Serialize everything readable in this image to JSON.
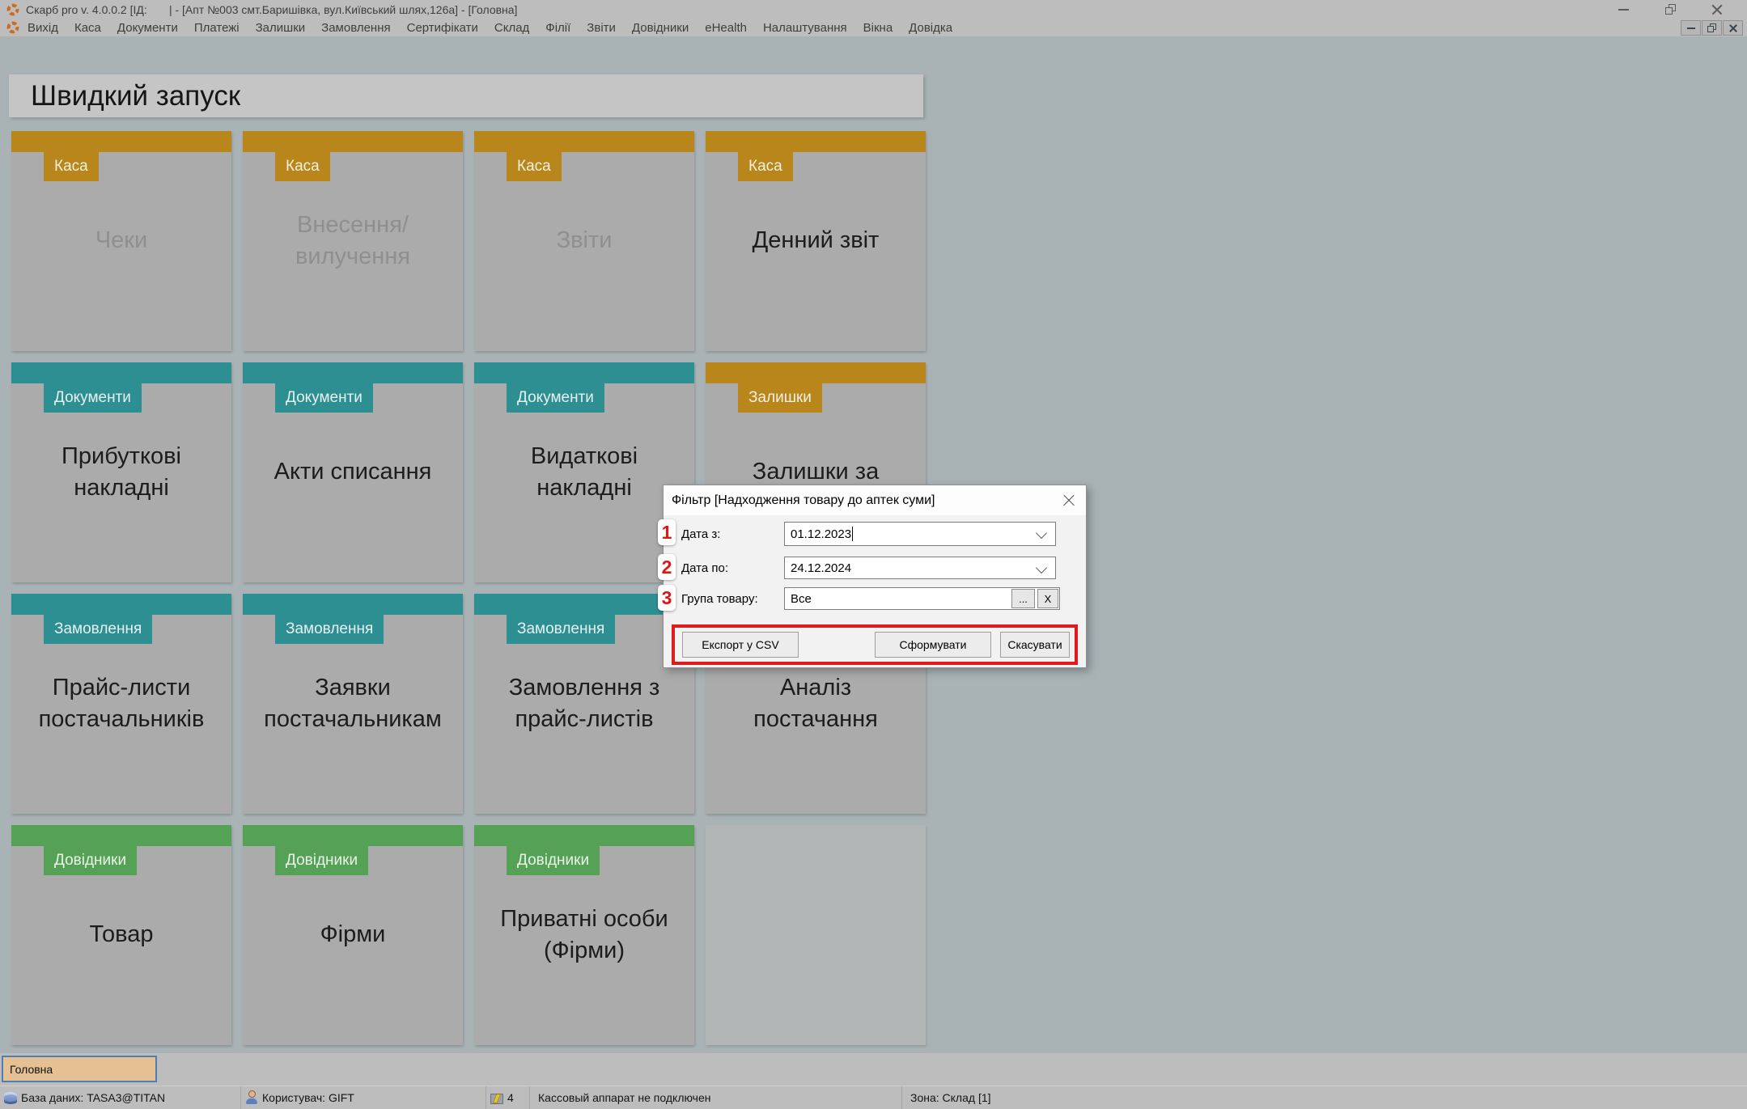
{
  "titlebar": {
    "title": "Скарб pro v. 4.0.0.2 [ІД:       | - [Апт №003 смт.Баришівка, вул.Київський шлях,126а] - [Головна]"
  },
  "menu": {
    "items": [
      {
        "label": "Вихід"
      },
      {
        "label": "Каса"
      },
      {
        "label": "Документи"
      },
      {
        "label": "Платежі"
      },
      {
        "label": "Залишки"
      },
      {
        "label": "Замовлення"
      },
      {
        "label": "Сертифікати"
      },
      {
        "label": "Склад"
      },
      {
        "label": "Філії"
      },
      {
        "label": "Звіти"
      },
      {
        "label": "Довідники"
      },
      {
        "label": "eHealth"
      },
      {
        "label": "Налаштування"
      },
      {
        "label": "Вікна"
      },
      {
        "label": "Довідка"
      }
    ]
  },
  "colors": {
    "gold": "#B8861B",
    "teal": "#2E8F93",
    "green": "#55A155"
  },
  "page": {
    "title": "Швидкий запуск"
  },
  "tiles": [
    {
      "category": "Каса",
      "color": "gold",
      "label": "Чеки",
      "disabled": true
    },
    {
      "category": "Каса",
      "color": "gold",
      "label": "Внесення/вилучення",
      "disabled": true
    },
    {
      "category": "Каса",
      "color": "gold",
      "label": "Звіти",
      "disabled": true
    },
    {
      "category": "Каса",
      "color": "gold",
      "label": "Денний звіт"
    },
    {
      "category": "Документи",
      "color": "teal",
      "label": "Прибуткові накладні"
    },
    {
      "category": "Документи",
      "color": "teal",
      "label": "Акти списання"
    },
    {
      "category": "Документи",
      "color": "teal",
      "label": "Видаткові накладні"
    },
    {
      "category": "Залишки",
      "color": "gold",
      "label": "Залишки за"
    },
    {
      "category": "Замовлення",
      "color": "teal",
      "label": "Прайс-листи постачальників"
    },
    {
      "category": "Замовлення",
      "color": "teal",
      "label": "Заявки постачальникам"
    },
    {
      "category": "Замовлення",
      "color": "teal",
      "label": "Замовлення з прайс-листів"
    },
    {
      "category": "Замовлення",
      "color": "teal",
      "label": "Аналіз постачання"
    },
    {
      "category": "Довідники",
      "color": "green",
      "label": "Товар"
    },
    {
      "category": "Довідники",
      "color": "green",
      "label": "Фірми"
    },
    {
      "category": "Довідники",
      "color": "green",
      "label": "Приватні особи (Фірми)"
    },
    {
      "empty": true
    }
  ],
  "dialog": {
    "title": "Фільтр [Надходження товару до аптек суми]",
    "fields": [
      {
        "num": "1",
        "label": "Дата з:",
        "value": "01.12.2023",
        "type": "combo",
        "focused": true
      },
      {
        "num": "2",
        "label": "Дата по:",
        "value": "24.12.2024",
        "type": "combo"
      },
      {
        "num": "3",
        "label": "Група товару:",
        "value": "Все",
        "type": "lookup",
        "browse": "...",
        "clear": "X"
      }
    ],
    "buttons": {
      "export": "Експорт у CSV",
      "generate": "Сформувати",
      "cancel": "Скасувати"
    }
  },
  "taskbar": {
    "active_tab": "Головна"
  },
  "statusbar": {
    "sections": [
      {
        "icon": "database-icon",
        "text": "База даних: TASA3@TITAN"
      },
      {
        "icon": "user-icon",
        "text": "Користувач: GIFT"
      },
      {
        "icon": "cash-register-icon",
        "text": "4"
      },
      {
        "text": "Кассовый аппарат не подключен"
      },
      {
        "text": "Зона: Склад [1]"
      }
    ]
  }
}
